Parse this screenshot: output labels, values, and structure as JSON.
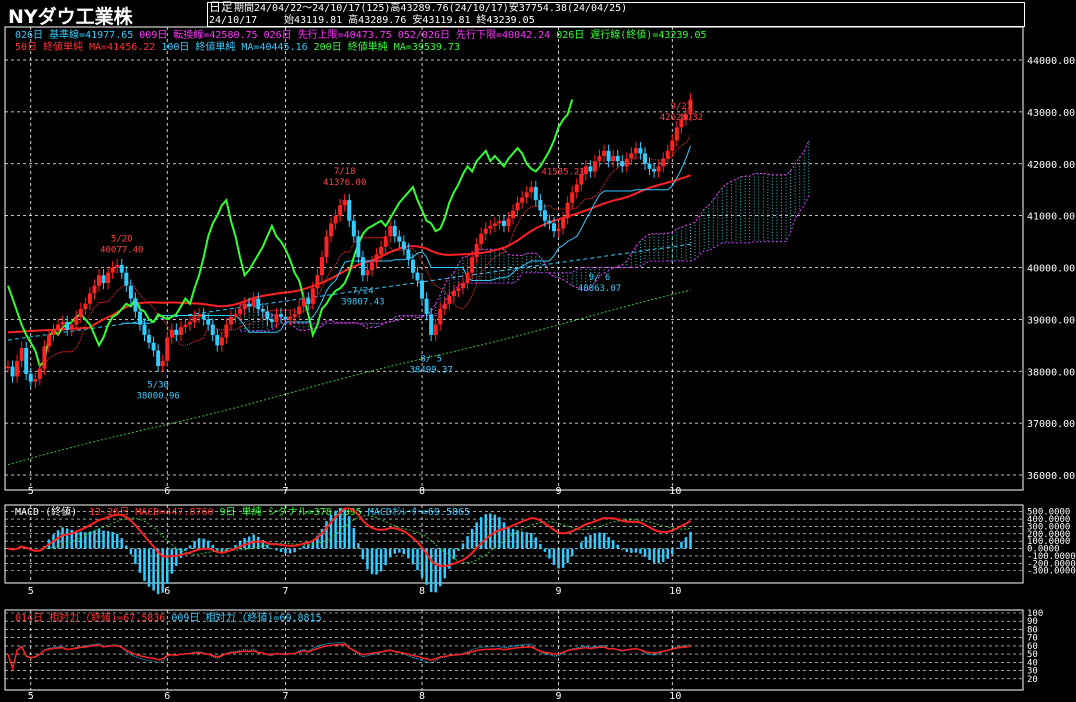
{
  "header": {
    "title": "NYダウ工業株",
    "period_type": "日足",
    "period_info": "期間24/04/22～24/10/17(125)高43289.76(24/10/17)安37754.38(24/04/25)",
    "date": "24/10/17",
    "ohlc": "始43119.81 高43289.76 安43119.81 終43239.05"
  },
  "legend": {
    "line1": [
      {
        "text": "026日 基準線=41977.65",
        "color": "#33ccff"
      },
      {
        "text": "009日 転換線=42580.75",
        "color": "#ff33ff"
      },
      {
        "text": "026日 先行上限=40473.75",
        "color": "#ff33ff"
      },
      {
        "text": "052/026日 先行下限=40042.24",
        "color": "#ff33ff"
      },
      {
        "text": "026日 遅行線(終値)=43239.05",
        "color": "#33ff33"
      }
    ],
    "line2": [
      {
        "text": "50日 終値単純 MA=41456.22",
        "color": "#ff3333"
      },
      {
        "text": "100日 終値単純 MA=40445.16",
        "color": "#33ccff"
      },
      {
        "text": "200日 終値単純 MA=39539.73",
        "color": "#33ff33"
      }
    ]
  },
  "macd_legend": {
    "title": "MACD (終値)",
    "items": [
      {
        "text": "12-26日 MACD=447.8760",
        "color": "#ff3333"
      },
      {
        "text": "9日 単純 シグナル=378.2895",
        "color": "#33ff33"
      },
      {
        "text": "MACDｵｼﾚｰﾀｰ=69.5865",
        "color": "#33ccff"
      }
    ]
  },
  "rsi_legend": {
    "items": [
      {
        "text": "014日 相対力 (終値)=67.5836",
        "color": "#ff3333"
      },
      {
        "text": "009日 相対力 (終値)=69.8815",
        "color": "#33ccff"
      }
    ]
  },
  "colors": {
    "up": "#ff2222",
    "down": "#33ccff",
    "grid": "#ffffff",
    "bg": "#000000"
  },
  "chart_data": [
    {
      "type": "candlestick",
      "name": "price",
      "ylim": [
        36000,
        44500
      ],
      "yticks": [
        "36000.00",
        "37000.00",
        "38000.00",
        "39000.00",
        "40000.00",
        "41000.00",
        "42000.00",
        "43000.00",
        "44000.00"
      ],
      "xticks": [
        "5",
        "6",
        "7",
        "8",
        "9",
        "10"
      ],
      "xtick_index": [
        5,
        35,
        61,
        91,
        121,
        146
      ],
      "closes": [
        38090,
        37900,
        38200,
        38450,
        37950,
        37800,
        37850,
        38050,
        38480,
        38700,
        38800,
        38900,
        38950,
        38800,
        38900,
        39050,
        39200,
        39300,
        39500,
        39650,
        39850,
        39700,
        39900,
        40000,
        40050,
        39900,
        39650,
        39400,
        39150,
        38900,
        38700,
        38550,
        38400,
        38100,
        38200,
        38650,
        38800,
        38700,
        38850,
        38900,
        38950,
        39050,
        39100,
        39000,
        38900,
        38700,
        38500,
        38650,
        38900,
        39050,
        39100,
        39200,
        39300,
        39250,
        39400,
        39200,
        39150,
        39000,
        38950,
        39100,
        39050,
        39000,
        39050,
        39100,
        39250,
        39400,
        39300,
        39600,
        39850,
        40200,
        40600,
        40850,
        41000,
        41200,
        41300,
        40900,
        40600,
        40200,
        39850,
        39950,
        40100,
        40250,
        40400,
        40600,
        40800,
        40600,
        40500,
        40350,
        40150,
        39900,
        39750,
        39400,
        39100,
        38700,
        38900,
        39200,
        39300,
        39450,
        39550,
        39600,
        39700,
        39900,
        40200,
        40450,
        40650,
        40750,
        40800,
        40850,
        40900,
        40800,
        40950,
        41100,
        41250,
        41350,
        41450,
        41550,
        41300,
        41100,
        40900,
        40850,
        40700,
        40750,
        40950,
        41250,
        41450,
        41600,
        41800,
        41950,
        41850,
        42050,
        42150,
        42250,
        42050,
        42150,
        42050,
        41950,
        42100,
        42200,
        42300,
        42200,
        42000,
        41900,
        41850,
        41950,
        42100,
        42250,
        42450,
        42700,
        42850,
        42950,
        43239
      ],
      "annotations": [
        {
          "label": "5/20",
          "value": "40077.40",
          "idx": 25,
          "price": 40077,
          "kind": "high"
        },
        {
          "label": "5/30",
          "value": "38000.96",
          "idx": 33,
          "price": 38000,
          "kind": "low"
        },
        {
          "label": "7/18",
          "value": "41376.00",
          "idx": 74,
          "price": 41376,
          "kind": "high"
        },
        {
          "label": "7/24",
          "value": "39807.43",
          "idx": 78,
          "price": 39807,
          "kind": "low"
        },
        {
          "label": "8/ 5",
          "value": "38499.37",
          "idx": 93,
          "price": 38499,
          "kind": "low"
        },
        {
          "label": "9/ 6",
          "value": "40063.07",
          "idx": 130,
          "price": 40063,
          "kind": "low"
        },
        {
          "label": "",
          "value": "41585.21",
          "idx": 122,
          "price": 41585,
          "kind": "high"
        },
        {
          "label": "9/27",
          "value": "42628.32",
          "idx": 148,
          "price": 42628,
          "kind": "high"
        }
      ]
    },
    {
      "type": "line",
      "name": "macd",
      "ylim": [
        -400,
        550
      ],
      "yticks": [
        "500.0000",
        "400.0000",
        "300.0000",
        "200.0000",
        "100.0000",
        "0.0000",
        "-100.0000",
        "-200.0000",
        "-300.0000"
      ]
    },
    {
      "type": "line",
      "name": "rsi",
      "ylim": [
        10,
        100
      ],
      "yticks": [
        "100",
        "90",
        "80",
        "70",
        "60",
        "50",
        "40",
        "30",
        "20"
      ]
    }
  ]
}
